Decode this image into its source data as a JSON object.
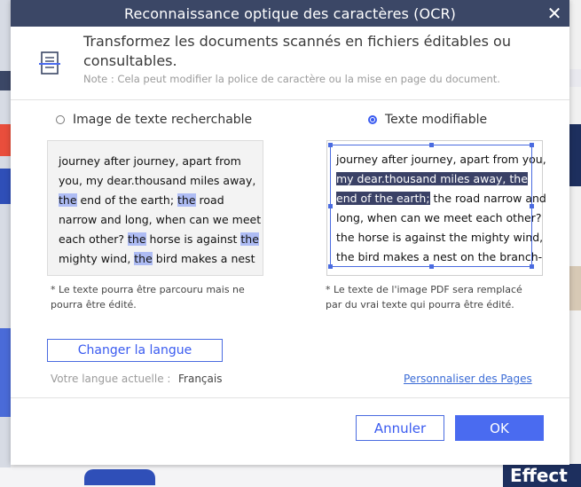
{
  "dialog": {
    "title": "Reconnaissance optique des caractères (OCR)",
    "header_text": "Transformez les documents scannés en fichiers éditables ou consultables.",
    "note": "Note : Cela peut modifier la police de caractère ou la mise en page du document."
  },
  "options": {
    "searchable": {
      "label": "Image de texte recherchable",
      "selected": false
    },
    "editable": {
      "label": "Texte modifiable",
      "selected": true
    }
  },
  "preview_left": {
    "lines": [
      [
        "journey after journey, apart from"
      ],
      [
        "you, my dear.thousand miles away,"
      ],
      [
        "the",
        " end of the earth; ",
        "the",
        " road"
      ],
      [
        "narrow and long, when can we meet"
      ],
      [
        "each other? ",
        "the",
        " horse is against ",
        "the"
      ],
      [
        "mighty wind, ",
        "the",
        " bird makes a nest"
      ]
    ]
  },
  "preview_right": {
    "lines": [
      [
        "journey after journey, apart from you,"
      ],
      [
        "my dear.thousand miles away, the"
      ],
      [
        "end of the earth;",
        " the road narrow and"
      ],
      [
        "long, when can we meet each other?"
      ],
      [
        "the horse is against the mighty wind,"
      ],
      [
        "the bird makes a nest on the branch-"
      ]
    ]
  },
  "footnotes": {
    "left": [
      "* Le texte pourra être parcouru mais ne",
      "pourra être édité."
    ],
    "right": [
      "* Le texte de l'image PDF sera remplacé",
      "par du vrai texte qui pourra être édité."
    ]
  },
  "language": {
    "button": "Changer la langue",
    "label": "Votre langue actuelle :",
    "value": "Français",
    "pages_link": "Personnaliser des Pages"
  },
  "buttons": {
    "cancel": "Annuler",
    "ok": "OK"
  },
  "background": {
    "effect_text": "Effect"
  },
  "colors": {
    "titlebar": "#3b4766",
    "accent": "#4a6bf0",
    "highlight": "#aebcf4",
    "selection": "#3a4166"
  }
}
